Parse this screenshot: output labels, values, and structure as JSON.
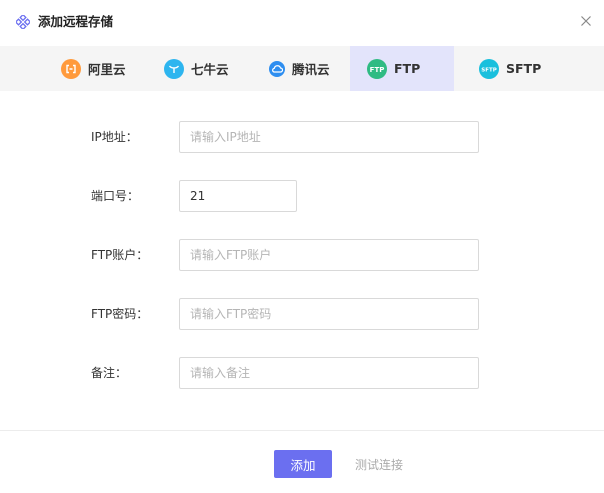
{
  "dialog": {
    "title": "添加远程存储",
    "logo_icon": "storage-cluster-icon",
    "close_icon": "close-icon"
  },
  "tabs": [
    {
      "label": "阿里云",
      "icon": "aliyun-icon",
      "color": "#ff9a3c",
      "active": false
    },
    {
      "label": "七牛云",
      "icon": "qiniu-icon",
      "color": "#2db5ef",
      "active": false
    },
    {
      "label": "腾讯云",
      "icon": "tencent-cloud-icon",
      "color": "#2e8ef0",
      "active": false
    },
    {
      "label": "FTP",
      "icon": "ftp-icon",
      "color": "#2fbb83",
      "active": true
    },
    {
      "label": "SFTP",
      "icon": "sftp-icon",
      "color": "#19c0dd",
      "active": false
    }
  ],
  "form": {
    "ip": {
      "label": "IP地址：",
      "value": "",
      "placeholder": "请输入IP地址"
    },
    "port": {
      "label": "端口号：",
      "value": "21",
      "placeholder": ""
    },
    "account": {
      "label": "FTP账户：",
      "value": "",
      "placeholder": "请输入FTP账户"
    },
    "password": {
      "label": "FTP密码：",
      "value": "",
      "placeholder": "请输入FTP密码"
    },
    "remark": {
      "label": "备注：",
      "value": "",
      "placeholder": "请输入备注"
    }
  },
  "actions": {
    "add_label": "添加",
    "test_label": "测试连接"
  },
  "colors": {
    "accent": "#6b6ff0",
    "active_tab_bg": "#e3e4fb"
  }
}
